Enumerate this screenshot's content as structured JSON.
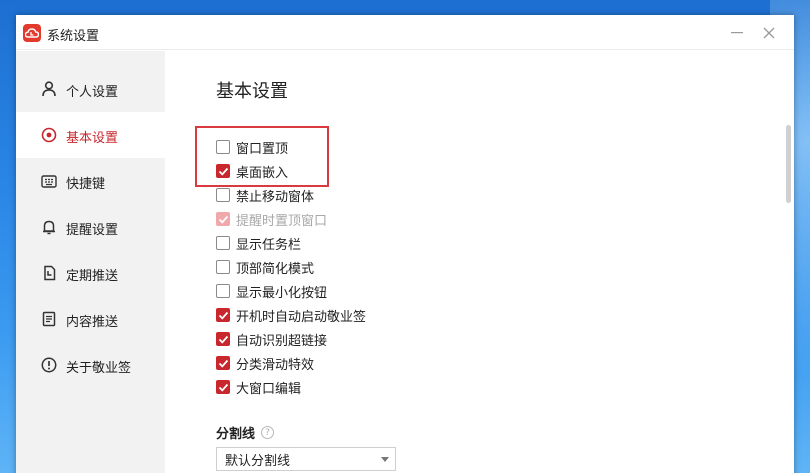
{
  "window": {
    "title": "系统设置",
    "accent": "#c8282d",
    "minimize_label": "—",
    "close_label": "✕"
  },
  "sidebar": {
    "items": [
      {
        "label": "个人设置",
        "icon": "user-icon",
        "active": false
      },
      {
        "label": "基本设置",
        "icon": "target-icon",
        "active": true
      },
      {
        "label": "快捷键",
        "icon": "keyboard-icon",
        "active": false
      },
      {
        "label": "提醒设置",
        "icon": "bell-icon",
        "active": false
      },
      {
        "label": "定期推送",
        "icon": "calendar-icon",
        "active": false
      },
      {
        "label": "内容推送",
        "icon": "document-icon",
        "active": false
      },
      {
        "label": "关于敬业签",
        "icon": "info-icon",
        "active": false
      }
    ]
  },
  "main": {
    "title": "基本设置",
    "options": [
      {
        "label": "窗口置顶",
        "checked": false,
        "disabled": false
      },
      {
        "label": "桌面嵌入",
        "checked": true,
        "disabled": false
      },
      {
        "label": "禁止移动窗体",
        "checked": false,
        "disabled": false
      },
      {
        "label": "提醒时置顶窗口",
        "checked": true,
        "disabled": true
      },
      {
        "label": "显示任务栏",
        "checked": false,
        "disabled": false
      },
      {
        "label": "顶部简化模式",
        "checked": false,
        "disabled": false
      },
      {
        "label": "显示最小化按钮",
        "checked": false,
        "disabled": false
      },
      {
        "label": "开机时自动启动敬业签",
        "checked": true,
        "disabled": false
      },
      {
        "label": "自动识别超链接",
        "checked": true,
        "disabled": false
      },
      {
        "label": "分类滑动特效",
        "checked": true,
        "disabled": false
      },
      {
        "label": "大窗口编辑",
        "checked": true,
        "disabled": false
      }
    ],
    "divider": {
      "heading": "分割线",
      "help_symbol": "?",
      "selected": "默认分割线"
    }
  }
}
